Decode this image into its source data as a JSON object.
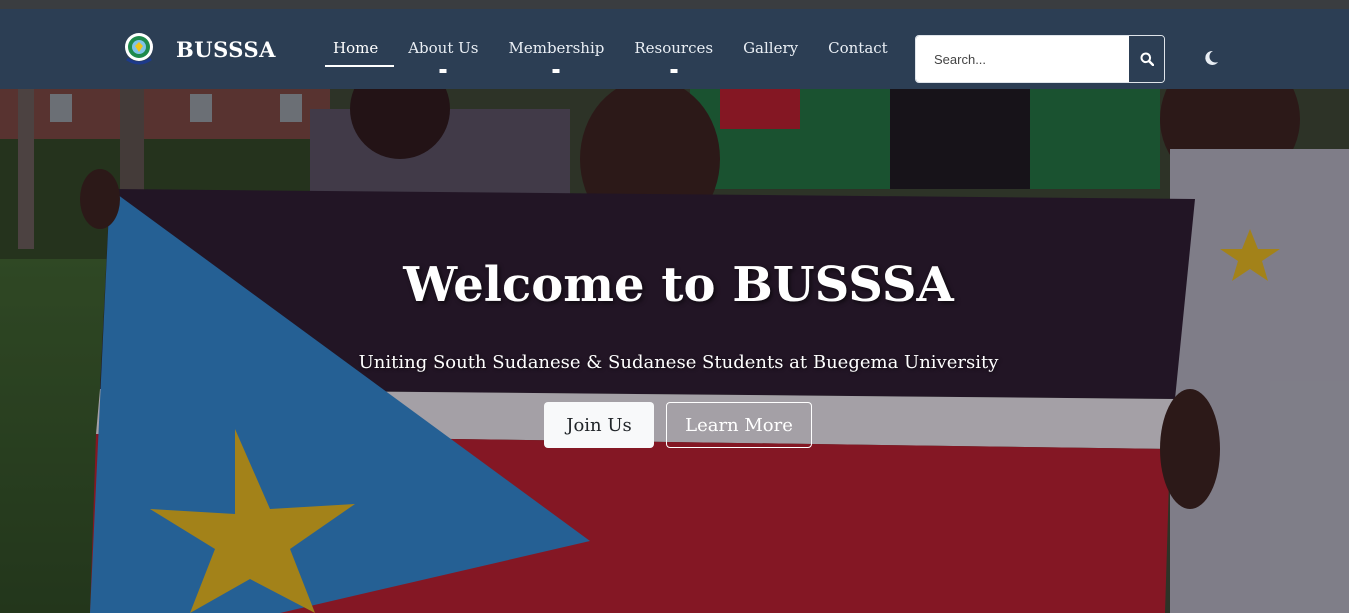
{
  "brand": {
    "name": "BUSSSA",
    "logo_icon": "association-emblem-icon"
  },
  "nav": {
    "items": [
      {
        "label": "Home",
        "active": true,
        "has_dropdown": false
      },
      {
        "label": "About Us",
        "active": false,
        "has_dropdown": true
      },
      {
        "label": "Membership",
        "active": false,
        "has_dropdown": true
      },
      {
        "label": "Resources",
        "active": false,
        "has_dropdown": true
      },
      {
        "label": "Gallery",
        "active": false,
        "has_dropdown": false
      },
      {
        "label": "Contact",
        "active": false,
        "has_dropdown": false
      }
    ]
  },
  "search": {
    "placeholder": "Search...",
    "value": "",
    "button_icon": "search-icon"
  },
  "theme_toggle": {
    "icon": "moon-icon"
  },
  "hero": {
    "title": "Welcome to BUSSSA",
    "subtitle": "Uniting South Sudanese & Sudanese Students at Buegema University",
    "primary_button": "Join Us",
    "secondary_button": "Learn More",
    "background_icon": "students-with-flag-photo"
  },
  "colors": {
    "navbar": "#2c3e54",
    "flag_blue": "#2f8fd6",
    "flag_red": "#c0202a",
    "flag_yellow": "#f0c419"
  }
}
